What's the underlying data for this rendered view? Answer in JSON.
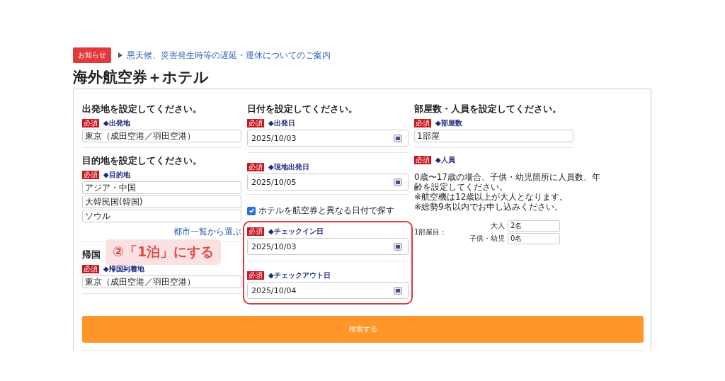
{
  "notice": {
    "badge": "お知らせ",
    "link": "悪天候、災害発生時等の遅延・運休についてのご案内"
  },
  "title": "海外航空券＋ホテル",
  "columns": [
    {
      "sections": [
        {
          "kind": "fields",
          "heading": "出発地を設定してください。",
          "fields": [
            {
              "required": "必須",
              "label": "◆出発地",
              "kind": "text",
              "values": [
                "東京（成田空港／羽田空港）"
              ]
            }
          ]
        },
        {
          "kind": "fields",
          "heading": "目的地を設定してください。",
          "fields": [
            {
              "required": "必須",
              "label": "◆目的地",
              "kind": "text",
              "values": [
                "アジア・中国",
                "大韓民国(韓国)",
                "ソウル"
              ]
            }
          ],
          "link": "都市一覧から選ぶ"
        },
        {
          "kind": "fields",
          "heading": "帰国",
          "fields": [
            {
              "required": "必須",
              "label": "◆帰国到着地",
              "kind": "text",
              "values": [
                "東京（成田空港／羽田空港）"
              ]
            }
          ]
        }
      ]
    },
    {
      "sections": [
        {
          "kind": "fields",
          "heading": "日付を設定してください。",
          "fields": [
            {
              "required": "必須",
              "label": "◆出発日",
              "kind": "date",
              "values": [
                "2025/10/03"
              ]
            },
            {
              "required": "必須",
              "label": "◆現地出発日",
              "kind": "date",
              "values": [
                "2025/10/05"
              ]
            }
          ]
        },
        {
          "kind": "checkbox",
          "label": "ホテルを航空券と異なる日付で探す",
          "checked": true
        },
        {
          "kind": "group",
          "highlighted": true,
          "fields": [
            {
              "required": "必須",
              "label": "◆チェックイン日",
              "kind": "date",
              "values": [
                "2025/10/03"
              ]
            },
            {
              "required": "必須",
              "label": "◆チェックアウト日",
              "kind": "date",
              "values": [
                "2025/10/04"
              ]
            }
          ]
        }
      ]
    },
    {
      "sections": [
        {
          "kind": "fields",
          "heading": "部屋数・人員を設定してください。",
          "fields": [
            {
              "required": "必須",
              "label": "◆部屋数",
              "kind": "text",
              "values": [
                "1部屋"
              ]
            }
          ]
        },
        {
          "kind": "people",
          "required": "必須",
          "label": "◆人員",
          "notes": [
            "0歳〜17歳の場合、子供・幼児箇所に人員数、年齢を設定してください。",
            "※航空機は12歳以上が大人となります。",
            "※総勢9名以内でお申し込みください。"
          ],
          "room": "1部屋目：",
          "counts": [
            {
              "label": "大人",
              "value": "2名"
            },
            {
              "label": "子供・幼児",
              "value": "0名"
            }
          ]
        }
      ]
    }
  ],
  "callout": "②「1泊」にする",
  "search_button": "検索する"
}
